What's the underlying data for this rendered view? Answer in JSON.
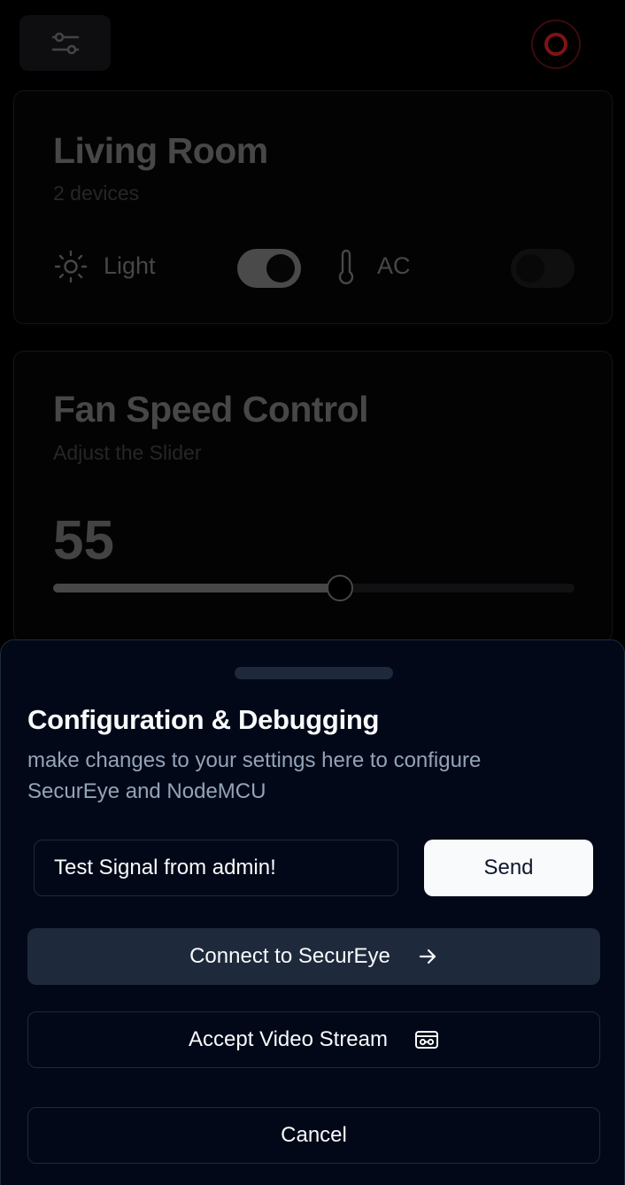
{
  "header": {
    "settings_icon": "sliders-icon",
    "power_icon": "power-ring-icon",
    "power_color": "#7f1217"
  },
  "room_card": {
    "title": "Living Room",
    "subtitle": "2 devices",
    "devices": [
      {
        "label": "Light",
        "icon": "sun-icon",
        "on": true
      },
      {
        "label": "AC",
        "icon": "thermometer-icon",
        "on": false
      }
    ]
  },
  "fan_card": {
    "title": "Fan Speed Control",
    "subtitle": "Adjust the Slider",
    "value": "55",
    "slider_percent": 55
  },
  "sheet": {
    "title": "Configuration & Debugging",
    "description": "make changes to your settings here to configure SecurEye and NodeMCU",
    "signal_input_value": "Test Signal from admin!",
    "send_label": "Send",
    "connect_label": "Connect to SecurEye",
    "connect_icon": "arrow-right-icon",
    "video_label": "Accept Video Stream",
    "video_icon": "vr-headset-icon",
    "cancel_label": "Cancel"
  },
  "colors": {
    "sheet_bg": "#020817",
    "border": "#1e293b",
    "primary_fg": "#f8fafc",
    "muted_fg": "#94a3b8"
  }
}
